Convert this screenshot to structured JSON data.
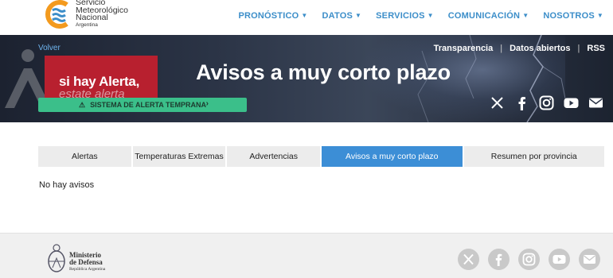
{
  "header": {
    "logo": {
      "line1": "Servicio",
      "line2": "Meteorológico",
      "line3": "Nacional",
      "line4": "Argentina"
    },
    "menu": [
      {
        "label": "PRONÓSTICO"
      },
      {
        "label": "DATOS"
      },
      {
        "label": "SERVICIOS"
      },
      {
        "label": "COMUNICACIÓN"
      },
      {
        "label": "NOSOTROS"
      }
    ]
  },
  "hero": {
    "back_label": "Volver",
    "title": "Avisos a muy corto plazo",
    "top_links": [
      "Transparencia",
      "Datos abiertos",
      "RSS"
    ],
    "alert_banner": {
      "line1": "si hay Alerta,",
      "line2": "estate alerta"
    },
    "alert_button_label": "SISTEMA DE ALERTA TEMPRANA",
    "social_icons": [
      "x-icon",
      "facebook-icon",
      "instagram-icon",
      "youtube-icon",
      "mail-icon"
    ]
  },
  "tabs": [
    {
      "label": "Alertas"
    },
    {
      "label": "Temperaturas Extremas"
    },
    {
      "label": "Advertencias"
    },
    {
      "label": "Avisos a muy corto plazo"
    },
    {
      "label": "Resumen por provincia"
    }
  ],
  "active_tab": "Avisos a muy corto plazo",
  "content": {
    "message": "No hay avisos"
  },
  "footer": {
    "ministerio": {
      "line1": "Ministerio",
      "line2": "de Defensa",
      "line3": "República Argentina"
    },
    "social_icons": [
      "x-icon",
      "facebook-icon",
      "instagram-icon",
      "youtube-icon",
      "mail-icon"
    ]
  },
  "colors": {
    "nav_text": "#3c8ec9",
    "active_tab": "#3c8ed6",
    "alert_button": "#3bbf8a",
    "alert_banner": "#b8202f",
    "footer_bg": "#f0f0f0"
  }
}
